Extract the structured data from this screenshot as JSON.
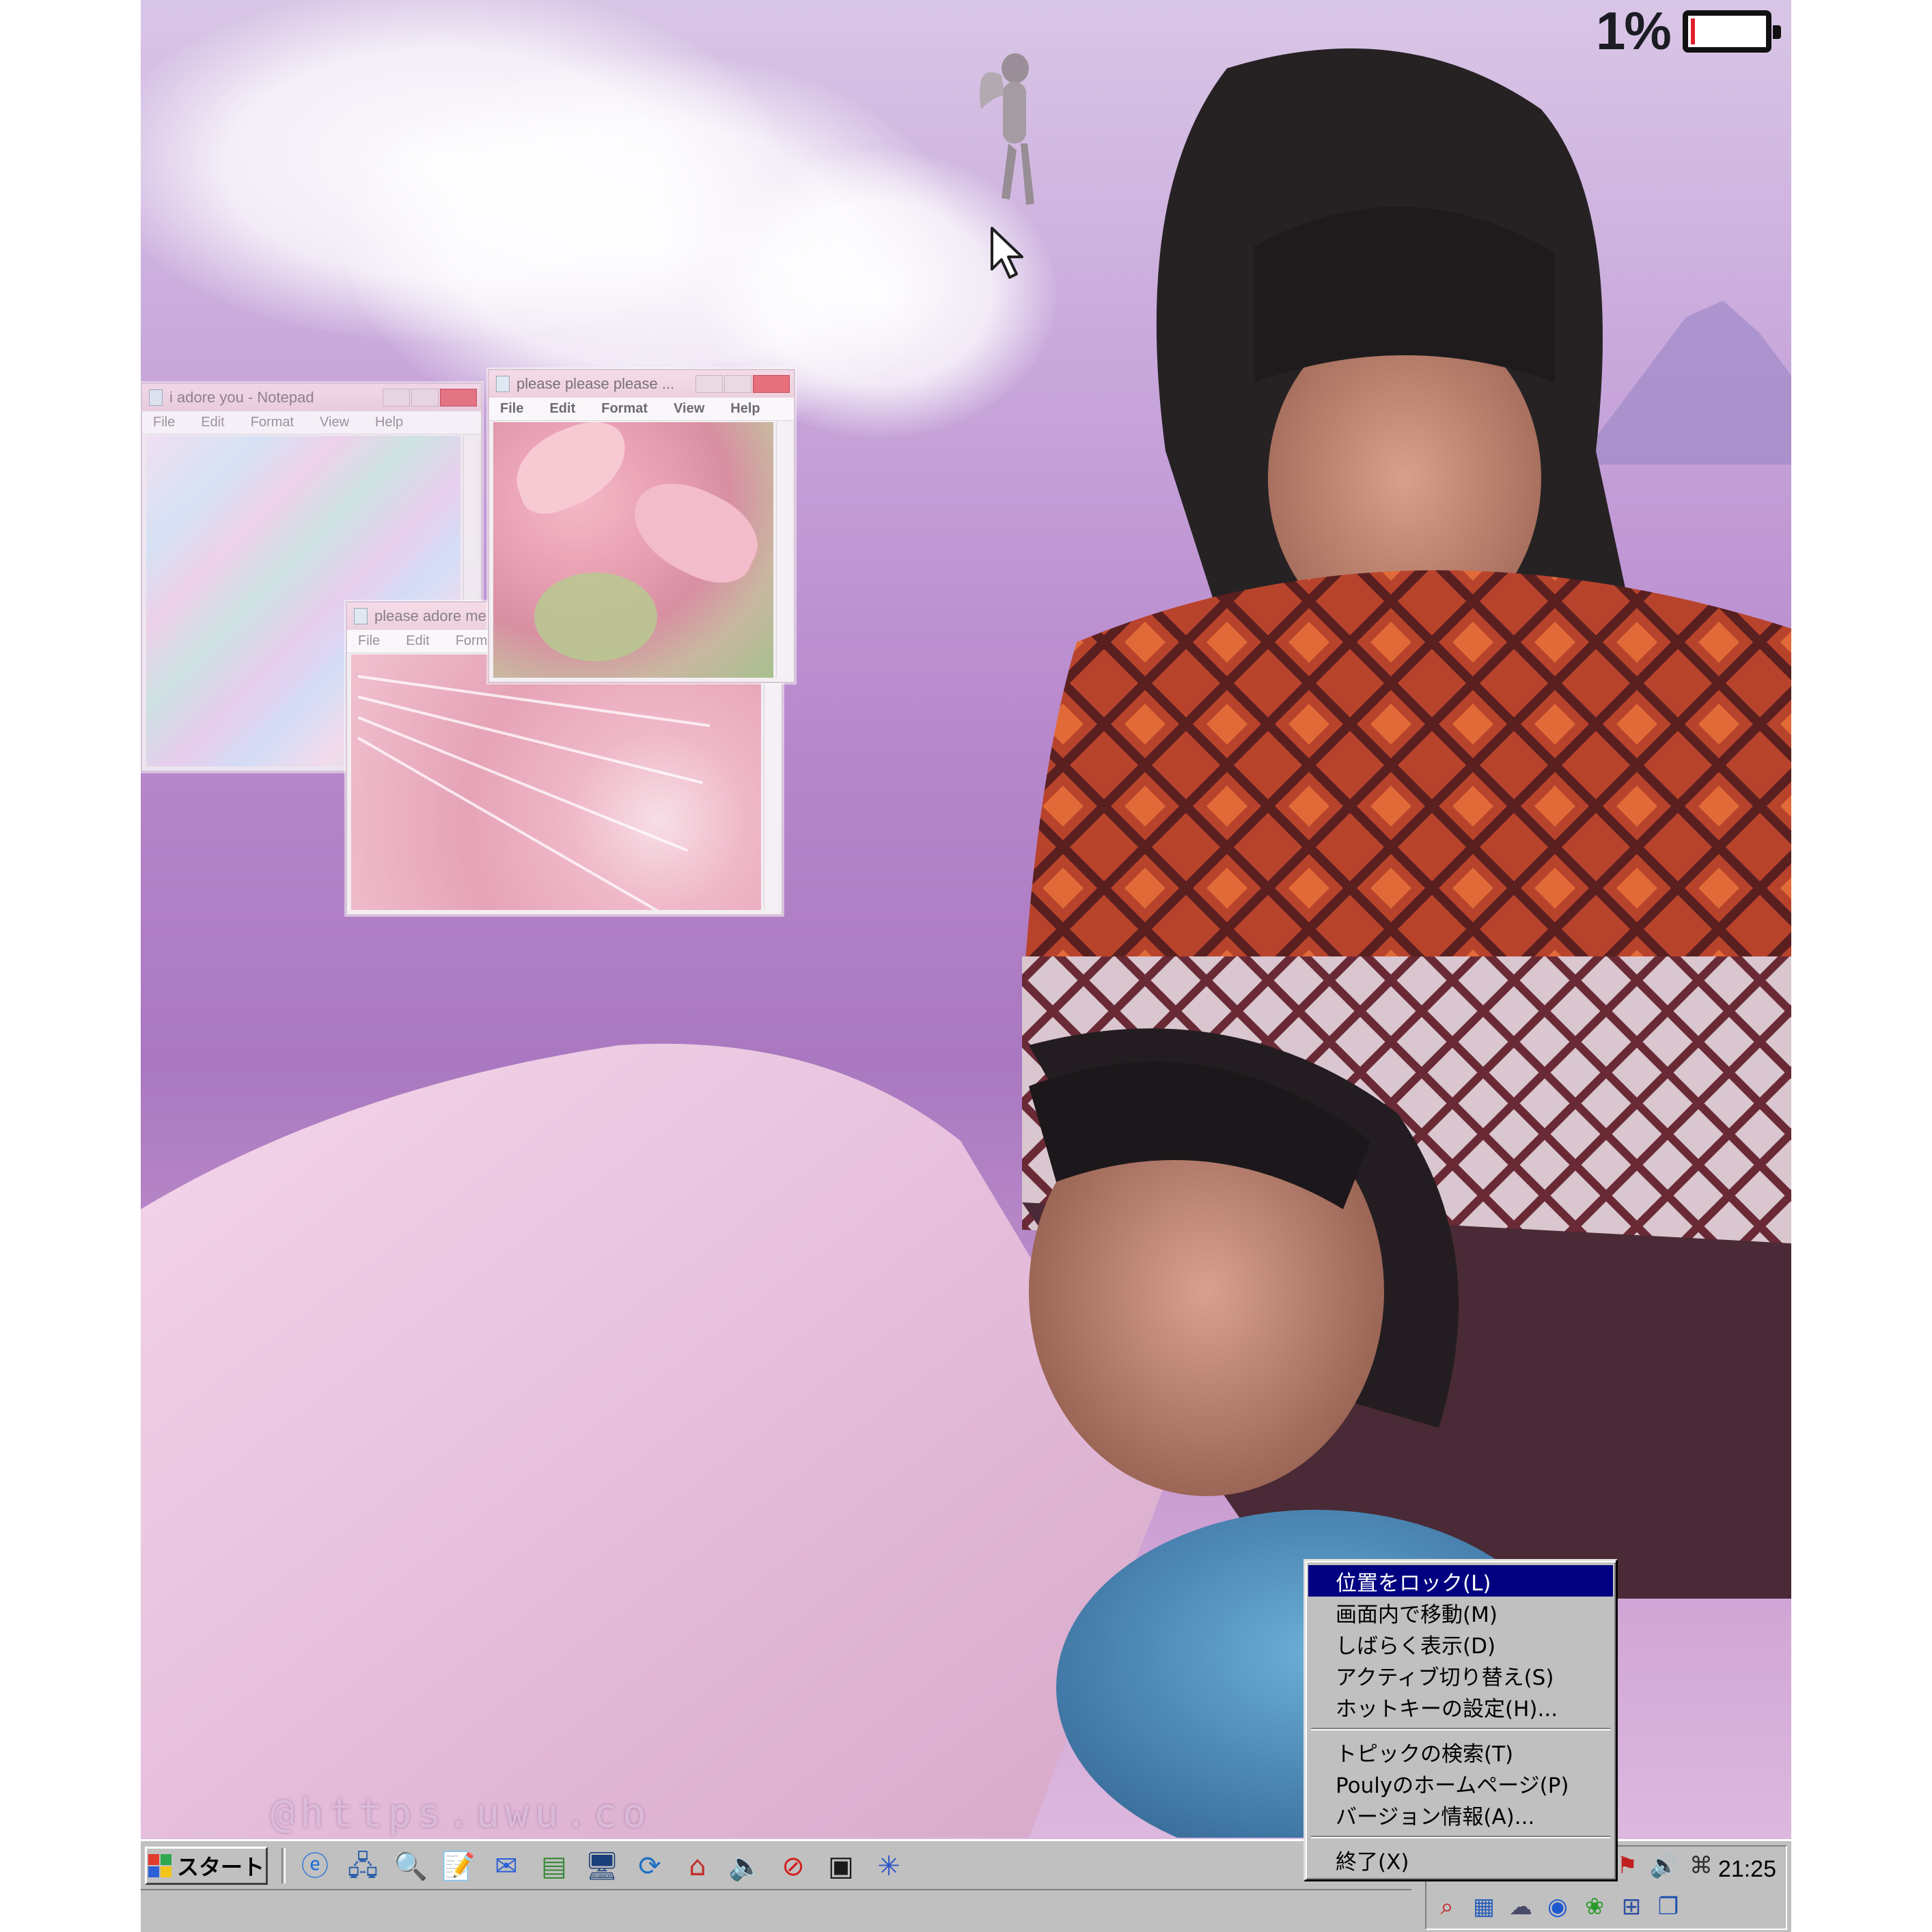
{
  "status": {
    "battery_percent_label": "1%",
    "battery_level": 0.01
  },
  "windows": [
    {
      "title": "i adore you - Notepad",
      "menu": [
        "File",
        "Edit",
        "Format",
        "View",
        "Help"
      ]
    },
    {
      "title": "please please please ...",
      "menu": [
        "File",
        "Edit",
        "Format",
        "View",
        "Help"
      ]
    },
    {
      "title": "please adore me",
      "menu": [
        "File",
        "Edit",
        "Format"
      ]
    }
  ],
  "watermark": "@https.uwu.co",
  "context_menu": {
    "items": [
      {
        "label": "位置をロック(L)",
        "selected": true
      },
      {
        "label": "画面内で移動(M)"
      },
      {
        "label": "しばらく表示(D)"
      },
      {
        "label": "アクティブ切り替え(S)"
      },
      {
        "label": "ホットキーの設定(H)..."
      },
      {
        "label": "トピックの検索(T)"
      },
      {
        "label": "Poulyのホームページ(P)"
      },
      {
        "label": "バージョン情報(A)..."
      },
      {
        "label": "終了(X)"
      }
    ]
  },
  "taskbar": {
    "start_label": "スタート",
    "quick_launch_icons": [
      "internet-explorer-icon",
      "network-icon",
      "search-icon",
      "notepad-icon",
      "mail-icon",
      "calculator-icon",
      "monitor-icon",
      "refresh-icon",
      "home-icon",
      "speaker-icon",
      "no-entry-icon",
      "media-icon",
      "sparkle-icon"
    ],
    "tray_icons": [
      "network-tray-icon",
      "volume-icon",
      "mouse-icon",
      "search-tray-icon",
      "picture-icon",
      "cloud-icon",
      "eye-icon",
      "leaf-icon",
      "grid-icon",
      "window-icon"
    ],
    "clock": "21:25"
  },
  "colors": {
    "menu_highlight": "#000080",
    "taskbar": "#c0c0c0",
    "battery_low": "#e0202a"
  }
}
